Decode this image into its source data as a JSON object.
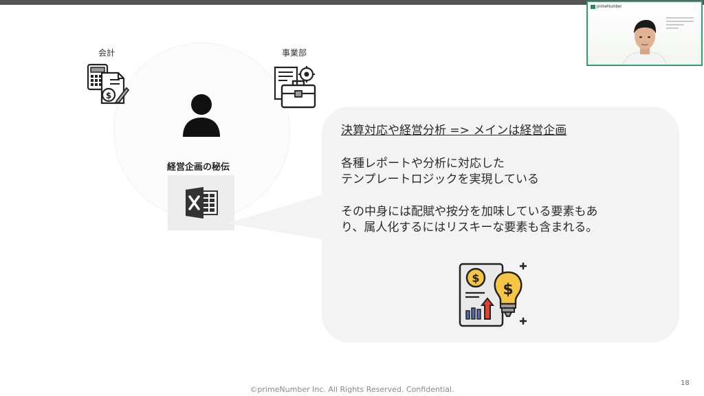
{
  "slide": {
    "page_number": "18",
    "footer": "©primeNumber Inc. All Rights Reserved. Confidential."
  },
  "labels": {
    "accounting": "会計",
    "business_dept": "事業部",
    "secret_title": "経営企画の秘伝"
  },
  "bubble": {
    "heading": "決算対応や経営分析 => メインは経営企画",
    "line1": "各種レポートや分析に対応した",
    "line2": "テンプレートロジックを実現している",
    "line3": "その中身には配賦や按分を加味している要素もあ",
    "line4": "り、属人化するにはリスキーな要素も含まれる。"
  },
  "video": {
    "logo_text": "primeNumber"
  },
  "icons": {
    "calculator": "calculator-document-icon",
    "business": "briefcase-document-icon",
    "person": "person-icon",
    "excel": "excel-icon",
    "idea": "money-idea-report-icon"
  },
  "colors": {
    "excel_box_bg": "#ececec",
    "bubble_bg": "#f3f3f3",
    "bulb_yellow": "#f6c544",
    "arrow_red": "#e0412e",
    "video_border": "#2f9e6f"
  }
}
